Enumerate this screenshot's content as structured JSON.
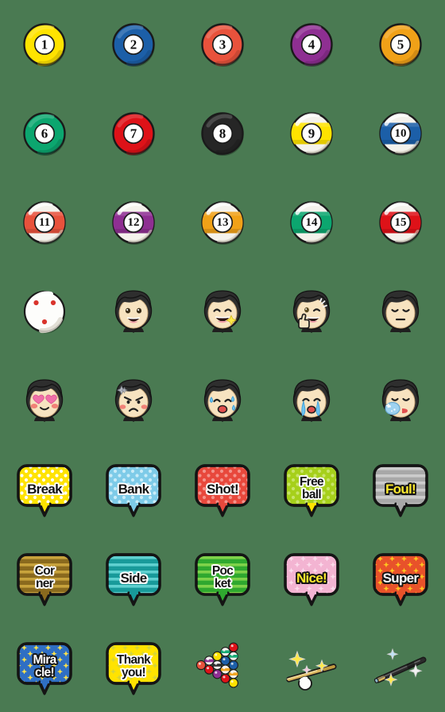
{
  "sheet": {
    "title": "Billiards Emoji Sticker Set",
    "background_color": "#4a7a52",
    "columns": 5,
    "rows": 8,
    "cell_size": 112
  },
  "palette": {
    "felt_green": "#4a7a52",
    "outline": "#1a1a1a",
    "white": "#ffffff",
    "yellow": "#ffe300",
    "blue": "#1c5fa8",
    "red_orange": "#e8523c",
    "purple": "#8e2f92",
    "orange": "#f0a118",
    "green": "#0ca66f",
    "red": "#de1218",
    "black": "#262626",
    "gray": "#a8a8a8",
    "pink": "#f3b4d2",
    "skin": "#f7e3c0",
    "hair": "#2e2e2e"
  },
  "items": [
    {
      "row": 1,
      "col": 1,
      "kind": "ball-solid",
      "name": "billiard-ball-1",
      "label": "1",
      "color": "#ffe300",
      "number": "1"
    },
    {
      "row": 1,
      "col": 2,
      "kind": "ball-solid",
      "name": "billiard-ball-2",
      "label": "2",
      "color": "#1c5fa8",
      "number": "2"
    },
    {
      "row": 1,
      "col": 3,
      "kind": "ball-solid",
      "name": "billiard-ball-3",
      "label": "3",
      "color": "#e8523c",
      "number": "3"
    },
    {
      "row": 1,
      "col": 4,
      "kind": "ball-solid",
      "name": "billiard-ball-4",
      "label": "4",
      "color": "#8e2f92",
      "number": "4"
    },
    {
      "row": 1,
      "col": 5,
      "kind": "ball-solid",
      "name": "billiard-ball-5",
      "label": "5",
      "color": "#f0a118",
      "number": "5"
    },
    {
      "row": 2,
      "col": 1,
      "kind": "ball-solid",
      "name": "billiard-ball-6",
      "label": "6",
      "color": "#0ca66f",
      "number": "6"
    },
    {
      "row": 2,
      "col": 2,
      "kind": "ball-solid",
      "name": "billiard-ball-7",
      "label": "7",
      "color": "#de1218",
      "number": "7"
    },
    {
      "row": 2,
      "col": 3,
      "kind": "ball-solid",
      "name": "billiard-ball-8",
      "label": "8",
      "color": "#262626",
      "number": "8"
    },
    {
      "row": 2,
      "col": 4,
      "kind": "ball-stripe",
      "name": "billiard-ball-9",
      "label": "9",
      "color": "#ffe300",
      "number": "9"
    },
    {
      "row": 2,
      "col": 5,
      "kind": "ball-stripe",
      "name": "billiard-ball-10",
      "label": "10",
      "color": "#1c5fa8",
      "number": "10"
    },
    {
      "row": 3,
      "col": 1,
      "kind": "ball-stripe",
      "name": "billiard-ball-11",
      "label": "11",
      "color": "#e8523c",
      "number": "11"
    },
    {
      "row": 3,
      "col": 2,
      "kind": "ball-stripe",
      "name": "billiard-ball-12",
      "label": "12",
      "color": "#8e2f92",
      "number": "12"
    },
    {
      "row": 3,
      "col": 3,
      "kind": "ball-stripe",
      "name": "billiard-ball-13",
      "label": "13",
      "color": "#f0a118",
      "number": "13"
    },
    {
      "row": 3,
      "col": 4,
      "kind": "ball-stripe",
      "name": "billiard-ball-14",
      "label": "14",
      "color": "#0ca66f",
      "number": "14"
    },
    {
      "row": 3,
      "col": 5,
      "kind": "ball-stripe",
      "name": "billiard-ball-15",
      "label": "15",
      "color": "#de1218",
      "number": "15"
    },
    {
      "row": 4,
      "col": 1,
      "kind": "cue-ball",
      "name": "cue-ball",
      "label": "cue ball"
    },
    {
      "row": 4,
      "col": 2,
      "kind": "face",
      "name": "face-smiling",
      "label": "smiling face",
      "face": "smile"
    },
    {
      "row": 4,
      "col": 3,
      "kind": "face",
      "name": "face-grinning-sparkle",
      "label": "grinning face with sparkle",
      "face": "grin-sparkle"
    },
    {
      "row": 4,
      "col": 4,
      "kind": "face",
      "name": "face-thumbs-up",
      "label": "face with thumbs up",
      "face": "thumbsup"
    },
    {
      "row": 4,
      "col": 5,
      "kind": "face",
      "name": "face-neutral",
      "label": "neutral face",
      "face": "neutral"
    },
    {
      "row": 5,
      "col": 1,
      "kind": "face",
      "name": "face-heart-eyes",
      "label": "heart eyes face",
      "face": "hearteyes"
    },
    {
      "row": 5,
      "col": 2,
      "kind": "face",
      "name": "face-angry",
      "label": "angry face",
      "face": "angry"
    },
    {
      "row": 5,
      "col": 3,
      "kind": "face",
      "name": "face-worried-sweat",
      "label": "worried sweating face",
      "face": "sweat"
    },
    {
      "row": 5,
      "col": 4,
      "kind": "face",
      "name": "face-crying",
      "label": "crying face",
      "face": "cry"
    },
    {
      "row": 5,
      "col": 5,
      "kind": "face",
      "name": "face-ice-pack",
      "label": "face with ice pack",
      "face": "icepack"
    },
    {
      "row": 6,
      "col": 1,
      "kind": "bubble",
      "name": "bubble-break",
      "text": "Break",
      "lines": 1,
      "bg": "#ffe300",
      "pattern": "dots",
      "dot": "#ffffff",
      "textStyle": "black",
      "tail": "#ffe300"
    },
    {
      "row": 6,
      "col": 2,
      "kind": "bubble",
      "name": "bubble-bank",
      "text": "Bank",
      "lines": 1,
      "bg": "#7ecbe8",
      "pattern": "dots",
      "dot": "#c9ecf8",
      "textStyle": "black",
      "tail": "#7ecbe8"
    },
    {
      "row": 6,
      "col": 3,
      "kind": "bubble",
      "name": "bubble-shot",
      "text": "Shot!",
      "lines": 1,
      "bg": "#e8483c",
      "pattern": "dots",
      "dot": "#f3938b",
      "textStyle": "black",
      "tail": "#e8483c"
    },
    {
      "row": 6,
      "col": 4,
      "kind": "bubble",
      "name": "bubble-free-ball",
      "text": "Free\nball",
      "lines": 2,
      "bg": "#a6d01a",
      "pattern": "dots",
      "dot": "#c8e46a",
      "textStyle": "black",
      "tail": "#ffe300"
    },
    {
      "row": 6,
      "col": 5,
      "kind": "bubble",
      "name": "bubble-foul",
      "text": "Foul!",
      "lines": 1,
      "bg": "#a8a8a8",
      "pattern": "stripes",
      "dot": "#cccccc",
      "textStyle": "yellow",
      "tail": "#a8a8a8"
    },
    {
      "row": 7,
      "col": 1,
      "kind": "bubble",
      "name": "bubble-corner",
      "text": "Cor\nner",
      "lines": 2,
      "bg": "#8a6a1e",
      "pattern": "stripes",
      "dot": "#c8a33c",
      "textStyle": "black",
      "tail": "#8a6a1e"
    },
    {
      "row": 7,
      "col": 2,
      "kind": "bubble",
      "name": "bubble-side",
      "text": "Side",
      "lines": 1,
      "bg": "#189a9a",
      "pattern": "stripes",
      "dot": "#5fd0cf",
      "textStyle": "black",
      "tail": "#189a9a"
    },
    {
      "row": 7,
      "col": 3,
      "kind": "bubble",
      "name": "bubble-pocket",
      "text": "Poc\nket",
      "lines": 2,
      "bg": "#2fa82f",
      "pattern": "stripes",
      "dot": "#7fd24a",
      "textStyle": "black",
      "tail": "#2fa82f"
    },
    {
      "row": 7,
      "col": 4,
      "kind": "bubble",
      "name": "bubble-nice",
      "text": "Nice!",
      "lines": 1,
      "bg": "#f3b4d2",
      "pattern": "stars",
      "dot": "#fbdcec",
      "textStyle": "yellow",
      "tail": "#f3b4d2"
    },
    {
      "row": 7,
      "col": 5,
      "kind": "bubble",
      "name": "bubble-super",
      "text": "Super",
      "lines": 1,
      "bg": "#e8522a",
      "pattern": "stars",
      "dot": "#ffc61e",
      "textStyle": "white",
      "tail": "#e8522a"
    },
    {
      "row": 8,
      "col": 1,
      "kind": "bubble",
      "name": "bubble-miracle",
      "text": "Mira\ncle!",
      "lines": 2,
      "bg": "#2f6fc4",
      "pattern": "stars",
      "dot": "#ffe34a",
      "textStyle": "white",
      "tail": "#2f6fc4"
    },
    {
      "row": 8,
      "col": 2,
      "kind": "bubble",
      "name": "bubble-thank-you",
      "text": "Thank\nyou!",
      "lines": 2,
      "bg": "#ffe300",
      "pattern": "stars",
      "dot": "#d4d43c",
      "textStyle": "black",
      "tail": "#ffe300"
    },
    {
      "row": 8,
      "col": 3,
      "kind": "rack",
      "name": "ball-rack-triangle",
      "label": "racked billiard balls"
    },
    {
      "row": 8,
      "col": 4,
      "kind": "cue-shot",
      "name": "cue-stick-with-ball",
      "label": "cue stick hitting ball"
    },
    {
      "row": 8,
      "col": 5,
      "kind": "cue-stick",
      "name": "cue-stick",
      "label": "cue stick"
    }
  ]
}
